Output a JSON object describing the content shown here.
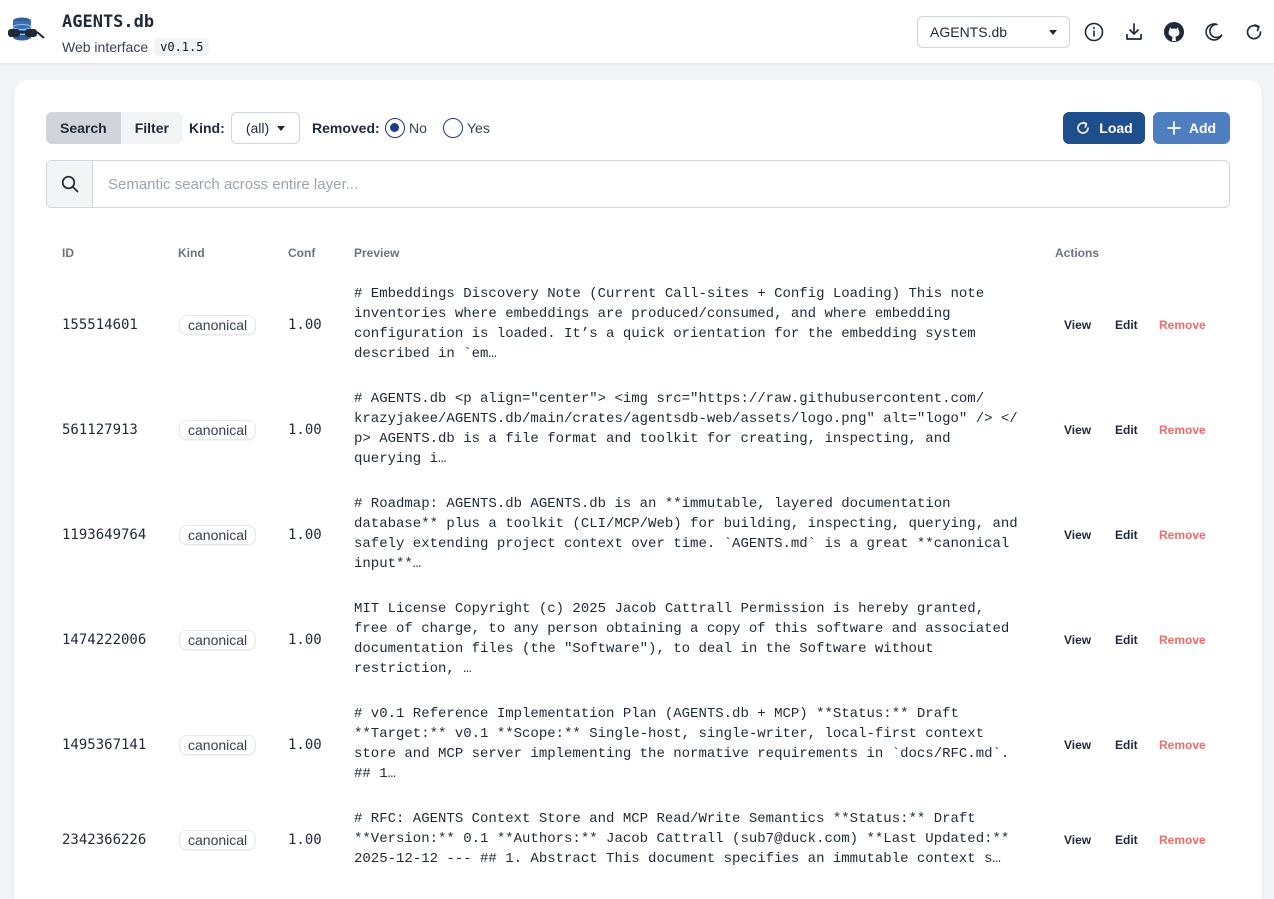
{
  "header": {
    "title": "AGENTS.db",
    "subtitle": "Web interface",
    "version": "v0.1.5",
    "db_select": "AGENTS.db",
    "icons": [
      "info-icon",
      "download-icon",
      "github-icon",
      "moon-icon",
      "refresh-icon"
    ]
  },
  "toolbar": {
    "mode_search": "Search",
    "mode_filter": "Filter",
    "kind_label": "Kind:",
    "kind_value": "(all)",
    "removed_label": "Removed:",
    "removed_no": "No",
    "removed_yes": "Yes",
    "removed_selected": "No",
    "load_label": "Load",
    "add_label": "Add"
  },
  "search": {
    "placeholder": "Semantic search across entire layer..."
  },
  "table": {
    "headers": {
      "id": "ID",
      "kind": "Kind",
      "conf": "Conf",
      "preview": "Preview",
      "actions": "Actions"
    },
    "action_labels": {
      "view": "View",
      "edit": "Edit",
      "remove": "Remove"
    },
    "rows": [
      {
        "id": "155514601",
        "kind": "canonical",
        "conf": "1.00",
        "preview": "# Embeddings Discovery Note (Current Call-sites + Config Loading) This note\ninventories where embeddings are produced/consumed, and where embedding\nconfiguration is loaded. It’s a quick orientation for the embedding system\ndescribed in `em…"
      },
      {
        "id": "561127913",
        "kind": "canonical",
        "conf": "1.00",
        "preview": "# AGENTS.db <p align=\"center\"> <img src=\"https://raw.githubusercontent.com/\nkrazyjakee/AGENTS.db/main/crates/agentsdb-web/assets/logo.png\" alt=\"logo\" /> </\np> AGENTS.db is a file format and toolkit for creating, inspecting, and\nquerying i…"
      },
      {
        "id": "1193649764",
        "kind": "canonical",
        "conf": "1.00",
        "preview": "# Roadmap: AGENTS.db AGENTS.db is an **immutable, layered documentation\ndatabase** plus a toolkit (CLI/MCP/Web) for building, inspecting, querying, and\nsafely extending project context over time. `AGENTS.md` is a great **canonical\ninput**…"
      },
      {
        "id": "1474222006",
        "kind": "canonical",
        "conf": "1.00",
        "preview": "MIT License Copyright (c) 2025 Jacob Cattrall Permission is hereby granted,\nfree of charge, to any person obtaining a copy of this software and associated\ndocumentation files (the \"Software\"), to deal in the Software without\nrestriction, …"
      },
      {
        "id": "1495367141",
        "kind": "canonical",
        "conf": "1.00",
        "preview": "# v0.1 Reference Implementation Plan (AGENTS.db + MCP) **Status:** Draft\n**Target:** v0.1 **Scope:** Single-host, single-writer, local-first context\nstore and MCP server implementing the normative requirements in `docs/RFC.md`.\n## 1…"
      },
      {
        "id": "2342366226",
        "kind": "canonical",
        "conf": "1.00",
        "preview": "# RFC: AGENTS Context Store and MCP Read/Write Semantics **Status:** Draft\n**Version:** 0.1 **Authors:** Jacob Cattrall (sub7@duck.com) **Last Updated:**\n2025-12-12 --- ## 1. Abstract This document specifies an immutable context s…"
      }
    ]
  }
}
